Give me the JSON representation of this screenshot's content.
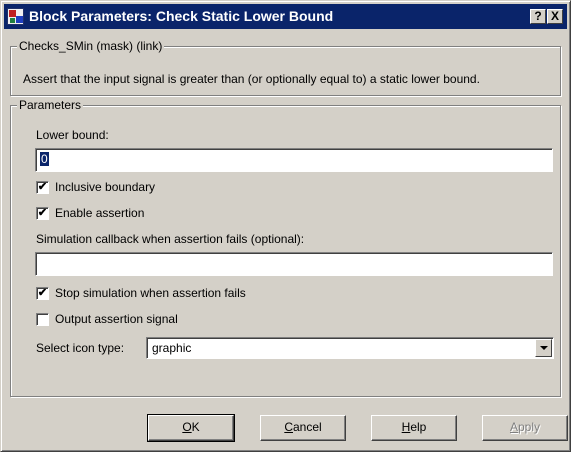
{
  "window": {
    "title": "Block Parameters: Check Static  Lower Bound",
    "help_glyph": "?",
    "close_glyph": "X"
  },
  "mask_group": {
    "legend": "Checks_SMin (mask) (link)",
    "description": "Assert that the input signal is greater than (or optionally equal to) a static lower bound."
  },
  "parameters": {
    "legend": "Parameters",
    "lower_bound_label": "Lower bound:",
    "lower_bound_value": "0",
    "inclusive_boundary": {
      "label": "Inclusive boundary",
      "checked": true
    },
    "enable_assertion": {
      "label": "Enable assertion",
      "checked": true
    },
    "callback_label": "Simulation callback when assertion fails (optional):",
    "callback_value": "",
    "stop_simulation": {
      "label": "Stop simulation when assertion fails",
      "checked": true
    },
    "output_assertion": {
      "label": "Output assertion signal",
      "checked": false
    },
    "icon_type_label": "Select icon type:",
    "icon_type_value": "graphic"
  },
  "buttons": {
    "ok_mnemonic": "O",
    "ok_rest": "K",
    "cancel_mnemonic": "C",
    "cancel_rest": "ancel",
    "help_mnemonic": "H",
    "help_rest": "elp",
    "apply_mnemonic": "A",
    "apply_rest": "pply"
  },
  "check_glyph": "✔",
  "colors": {
    "titlebar": "#0a246a",
    "dialog_face": "#d4d0c8",
    "selection": "#0a246a"
  }
}
